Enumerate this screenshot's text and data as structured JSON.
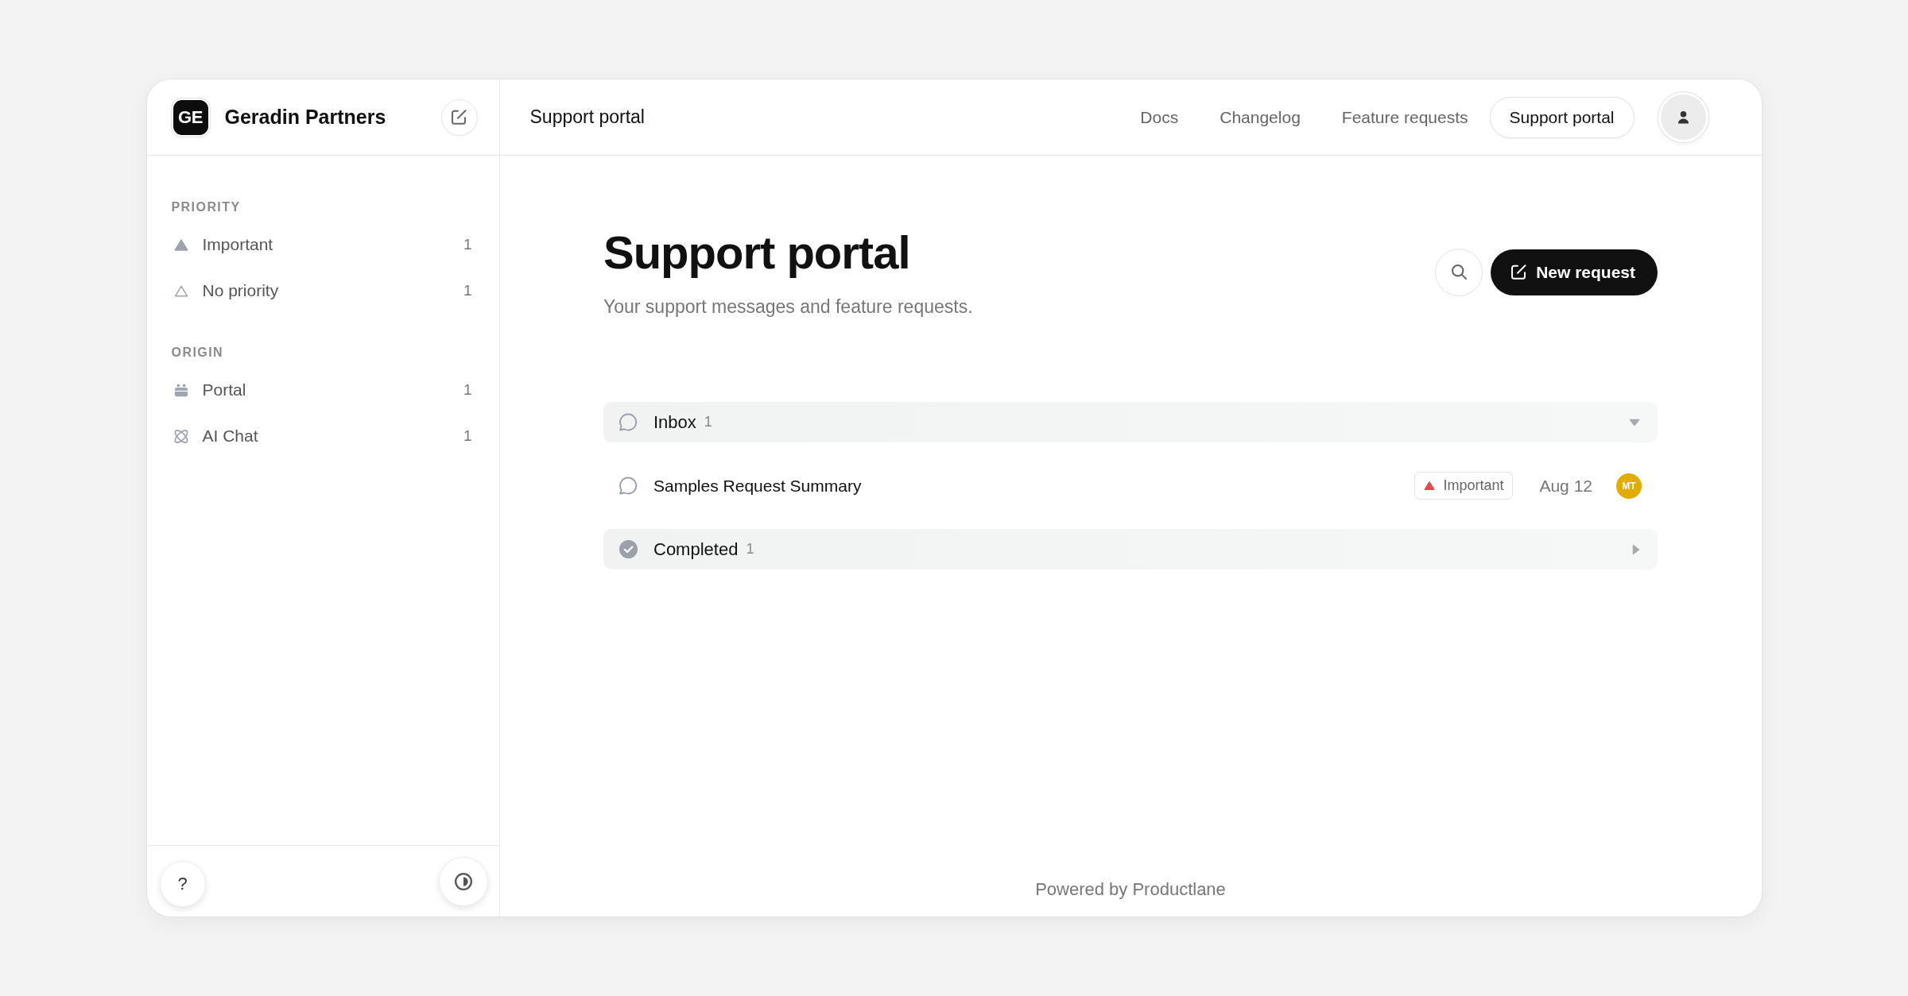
{
  "workspace": {
    "logo": "GE",
    "name": "Geradin Partners"
  },
  "sidebar": {
    "sections": [
      {
        "title": "PRIORITY",
        "items": [
          {
            "kind": "important",
            "label": "Important",
            "count": "1",
            "selected": false
          },
          {
            "kind": "none",
            "label": "No priority",
            "count": "1",
            "selected": false
          }
        ]
      },
      {
        "title": "ORIGIN",
        "items": [
          {
            "kind": "portal",
            "label": "Portal",
            "count": "1",
            "selected": false
          },
          {
            "kind": "chat",
            "label": "AI Chat",
            "count": "1",
            "selected": false
          }
        ]
      }
    ],
    "help_button": "?"
  },
  "topbar": {
    "title": "Support portal",
    "nav": [
      {
        "label": "Docs",
        "selected": false
      },
      {
        "label": "Changelog",
        "selected": false
      },
      {
        "label": "Feature requests",
        "selected": false
      },
      {
        "label": "Support portal",
        "selected": true
      }
    ]
  },
  "page": {
    "title": "Support portal",
    "subtitle": "Your support messages and feature requests.",
    "primary_button": "New request"
  },
  "groups": [
    {
      "kind": "inbox",
      "title": "Inbox",
      "count": "1",
      "expanded": true,
      "requests": [
        {
          "title": "Samples Request Summary",
          "priority": "Important",
          "date": "Aug 12",
          "assignee": "MT"
        }
      ]
    },
    {
      "kind": "completed",
      "title": "Completed",
      "count": "1",
      "expanded": false
    }
  ],
  "footer": "Powered by Productlane"
}
